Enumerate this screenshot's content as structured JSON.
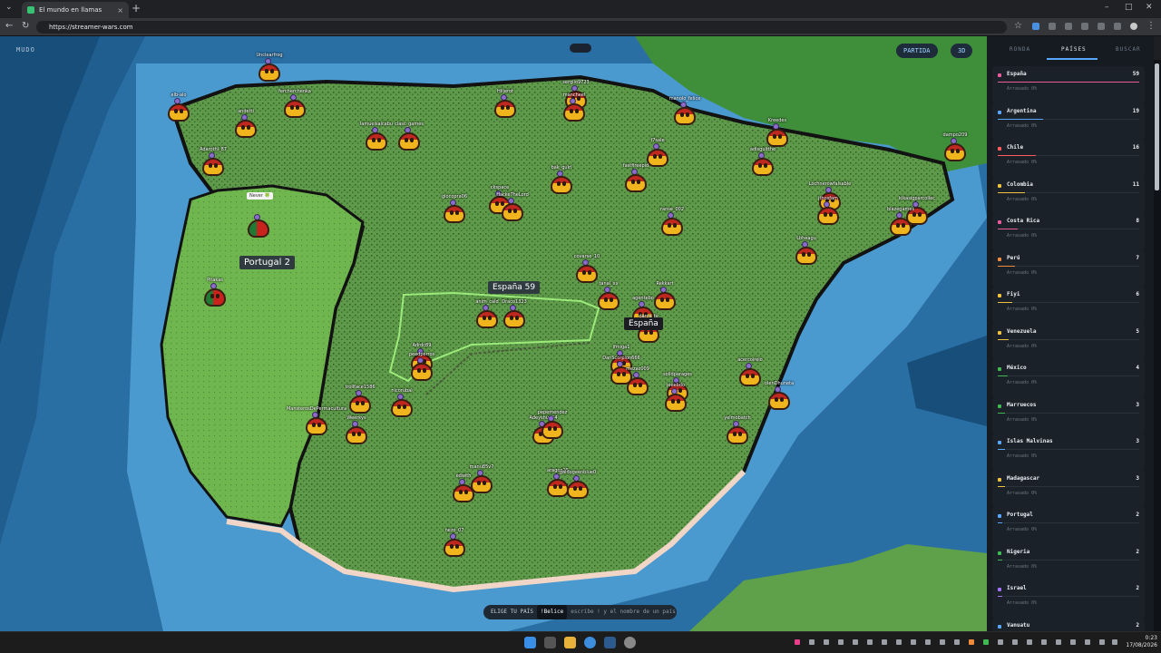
{
  "browser": {
    "tab_title": "El mundo en llamas",
    "url": "https://streamer-wars.com"
  },
  "map": {
    "mode_label": "MUDO",
    "buttons": {
      "partida": "PARTIDA",
      "view3d": "3D"
    },
    "labels": {
      "espana_count": "España 59",
      "espana": "España",
      "portugal": "Portugal 2"
    },
    "bubble": "Never 🍀",
    "chooser": {
      "label": "ELIGE TU PAÍS",
      "command": "!Belice",
      "hint": "escribe ! y el nombre de un país"
    },
    "usernames": [
      "Unclearfrog",
      "elb-alo",
      "fercherchenka",
      "andetti",
      "Adarothi_87",
      "lamuelsalcabu",
      "clasc_games",
      "Hiijerot",
      "sergiio9723",
      "mancheel",
      "manolo_felice",
      "Kreedes",
      "dampo209",
      "f7sale",
      "fastfireepid",
      "bak_guirl",
      "adisguitthe",
      "glocopra06",
      "ckspace",
      "HackeTheLord",
      "Lochnerowfalsable",
      "jthosfam",
      "kikasigparcollec",
      "blazegames",
      "ranse_002",
      "Lbheagu",
      "covarse_10",
      "tanal_xx",
      "Rekkart",
      "agentebo",
      "daros_tv",
      "anim_cald",
      "Draco1323",
      "Adrdc89",
      "peedperros",
      "lfmiga1",
      "DanScorpion666",
      "solidparages",
      "jeeebdo",
      "acercoirelo",
      "mezaz009",
      "olenDhuneta",
      "trollface1586",
      "nicorubal",
      "MansterosDePermacultura",
      "Weerkys",
      "Adeyshun54",
      "pepemendez",
      "yelmobatch",
      "manu85v7",
      "edwith",
      "aragon25",
      "galdogeenblue0",
      "nezo_07",
      "Pitakas"
    ]
  },
  "panel": {
    "tabs": [
      "RONDA",
      "PAÍSES",
      "BUSCAR"
    ],
    "active_tab": "PAÍSES",
    "countries": [
      {
        "name": "España",
        "count": "59",
        "sub": "Arrasado 0%",
        "color": "#e85d9b",
        "fill": 1.0
      },
      {
        "name": "Argentina",
        "count": "19",
        "sub": "Arrasado 0%",
        "color": "#58a6ff",
        "fill": 0.32
      },
      {
        "name": "Chile",
        "count": "16",
        "sub": "Arrasado 0%",
        "color": "#ff5c5c",
        "fill": 0.27
      },
      {
        "name": "Colombia",
        "count": "11",
        "sub": "Arrasado 0%",
        "color": "#f0c040",
        "fill": 0.19
      },
      {
        "name": "Costa Rica",
        "count": "8",
        "sub": "Arrasado 0%",
        "color": "#e85d9b",
        "fill": 0.14
      },
      {
        "name": "Perú",
        "count": "7",
        "sub": "Arrasado 0%",
        "color": "#f08a3c",
        "fill": 0.12
      },
      {
        "name": "Fiyi",
        "count": "6",
        "sub": "Arrasado 0%",
        "color": "#f0c040",
        "fill": 0.1
      },
      {
        "name": "Venezuela",
        "count": "5",
        "sub": "Arrasado 0%",
        "color": "#f0c040",
        "fill": 0.08
      },
      {
        "name": "México",
        "count": "4",
        "sub": "Arrasado 0%",
        "color": "#3fb950",
        "fill": 0.07
      },
      {
        "name": "Marruecos",
        "count": "3",
        "sub": "Arrasado 0%",
        "color": "#3fb950",
        "fill": 0.05
      },
      {
        "name": "Islas Malvinas",
        "count": "3",
        "sub": "Arrasado 0%",
        "color": "#58a6ff",
        "fill": 0.05
      },
      {
        "name": "Madagascar",
        "count": "3",
        "sub": "Arrasado 0%",
        "color": "#f0c040",
        "fill": 0.05
      },
      {
        "name": "Portugal",
        "count": "2",
        "sub": "Arrasado 0%",
        "color": "#58a6ff",
        "fill": 0.03
      },
      {
        "name": "Nigeria",
        "count": "2",
        "sub": "Arrasado 0%",
        "color": "#3fb950",
        "fill": 0.03
      },
      {
        "name": "Israel",
        "count": "2",
        "sub": "Arrasado 0%",
        "color": "#a371f7",
        "fill": 0.03
      },
      {
        "name": "Vanuatu",
        "count": "2",
        "sub": "",
        "color": "#58a6ff",
        "fill": 0.03
      }
    ]
  },
  "taskbar": {
    "time": "0:23",
    "date": "17/08/2026"
  }
}
